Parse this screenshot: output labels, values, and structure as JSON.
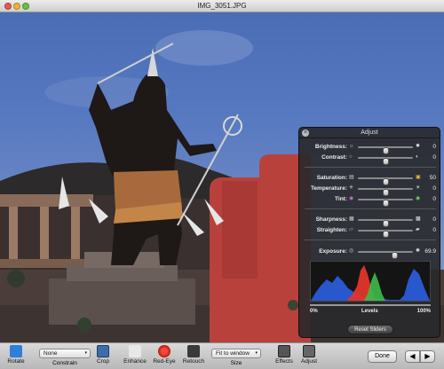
{
  "window": {
    "title": "IMG_3051.JPG"
  },
  "hud": {
    "title": "Adjust",
    "sliders_group1": [
      {
        "label": "Brightness:",
        "left_icon": "sun-small-icon",
        "right_icon": "sun-large-icon",
        "value": "0",
        "level": 0.5
      },
      {
        "label": "Contrast:",
        "left_icon": "contrast-low-icon",
        "right_icon": "contrast-high-icon",
        "value": "0",
        "level": 0.5
      }
    ],
    "sliders_group2": [
      {
        "label": "Saturation:",
        "left_icon": "saturation-low-icon",
        "right_icon": "saturation-high-icon",
        "value": "50",
        "level": 0.5
      },
      {
        "label": "Temperature:",
        "left_icon": "snowflake-icon",
        "right_icon": "sun-icon",
        "value": "0",
        "level": 0.5
      },
      {
        "label": "Tint:",
        "left_icon": "magenta-circle-icon",
        "right_icon": "green-circle-icon",
        "value": "0",
        "level": 0.5
      }
    ],
    "sliders_group3": [
      {
        "label": "Sharpness:",
        "left_icon": "blur-icon",
        "right_icon": "sharp-icon",
        "value": "0",
        "level": 0.5
      },
      {
        "label": "Straighten:",
        "left_icon": "tilt-left-icon",
        "right_icon": "tilt-right-icon",
        "value": "0",
        "level": 0.5
      }
    ],
    "exposure": {
      "label": "Exposure:",
      "value": "69.9",
      "level": 0.66
    },
    "levels": {
      "left": "0%",
      "center": "Levels",
      "right": "100%"
    },
    "reset_label": "Reset Sliders"
  },
  "toolbar": {
    "rotate_label": "Rotate",
    "constrain_value": "None",
    "constrain_label": "Constrain",
    "crop_label": "Crop",
    "enhance_label": "Enhance",
    "redeye_label": "Red-Eye",
    "retouch_label": "Retouch",
    "size_value": "Fit to window",
    "size_label": "Size",
    "effects_label": "Effects",
    "adjust_label": "Adjust",
    "done_label": "Done"
  },
  "colors": {
    "hud_bg": "#28282a",
    "sky": "#5578c0",
    "adobe_wall": "#b8413c"
  }
}
